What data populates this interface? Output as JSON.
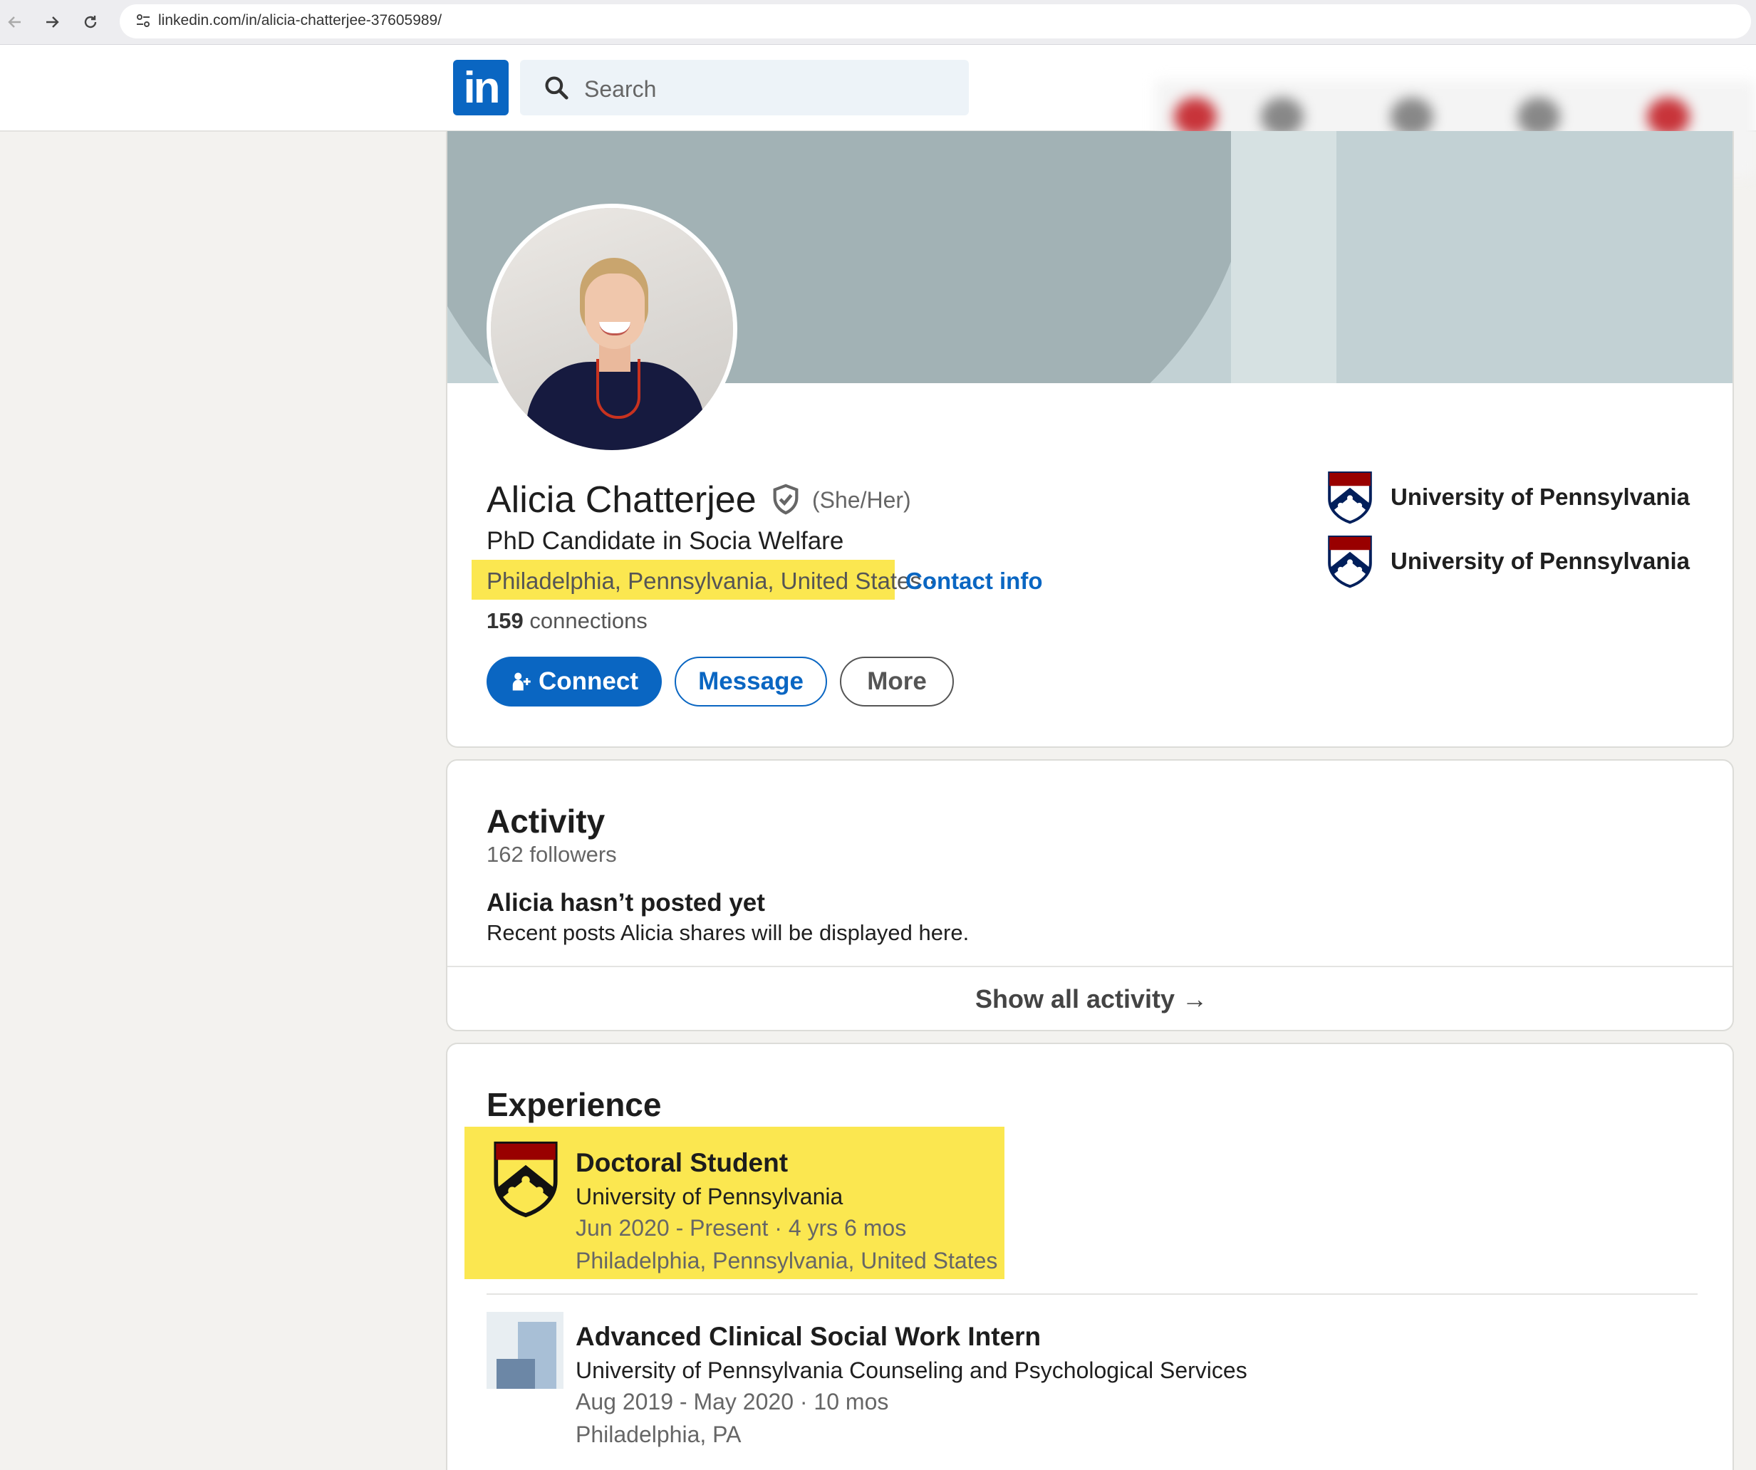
{
  "browser": {
    "url": "linkedin.com/in/alicia-chatterjee-37605989/",
    "back_icon": "arrow-left-icon",
    "forward_icon": "arrow-right-icon",
    "reload_icon": "reload-icon",
    "site_info_icon": "tune-icon"
  },
  "header": {
    "logo_text": "in",
    "search_placeholder": "Search"
  },
  "colors": {
    "brand": "#0a66c2",
    "highlight": "#fbe750",
    "background": "#f3f2ef",
    "penn_red": "#990000",
    "penn_navy": "#011f5b"
  },
  "profile": {
    "name": "Alicia Chatterjee",
    "pronouns": "(She/Her)",
    "headline": "PhD Candidate in Socia Welfare",
    "location": "Philadelphia, Pennsylvania, United States",
    "separator": "·",
    "contact_info": "Contact info",
    "connections_count": "159",
    "connections_label": "connections",
    "buttons": {
      "connect": "Connect",
      "message": "Message",
      "more": "More"
    },
    "education": [
      {
        "name": "University of Pennsylvania"
      },
      {
        "name": "University of Pennsylvania"
      }
    ]
  },
  "activity": {
    "title": "Activity",
    "followers": "162 followers",
    "empty_title": "Alicia hasn’t posted yet",
    "empty_text": "Recent posts Alicia shares will be displayed here.",
    "show_all": "Show all activity →"
  },
  "experience": {
    "title": "Experience",
    "items": [
      {
        "title": "Doctoral Student",
        "org": "University of Pennsylvania",
        "dates": "Jun 2020 - Present · 4 yrs 6 mos",
        "location": "Philadelphia, Pennsylvania, United States"
      },
      {
        "title": "Advanced Clinical Social Work Intern",
        "org": "University of Pennsylvania Counseling and Psychological Services",
        "dates": "Aug 2019 - May 2020 · 10 mos",
        "location": "Philadelphia, PA"
      }
    ]
  }
}
